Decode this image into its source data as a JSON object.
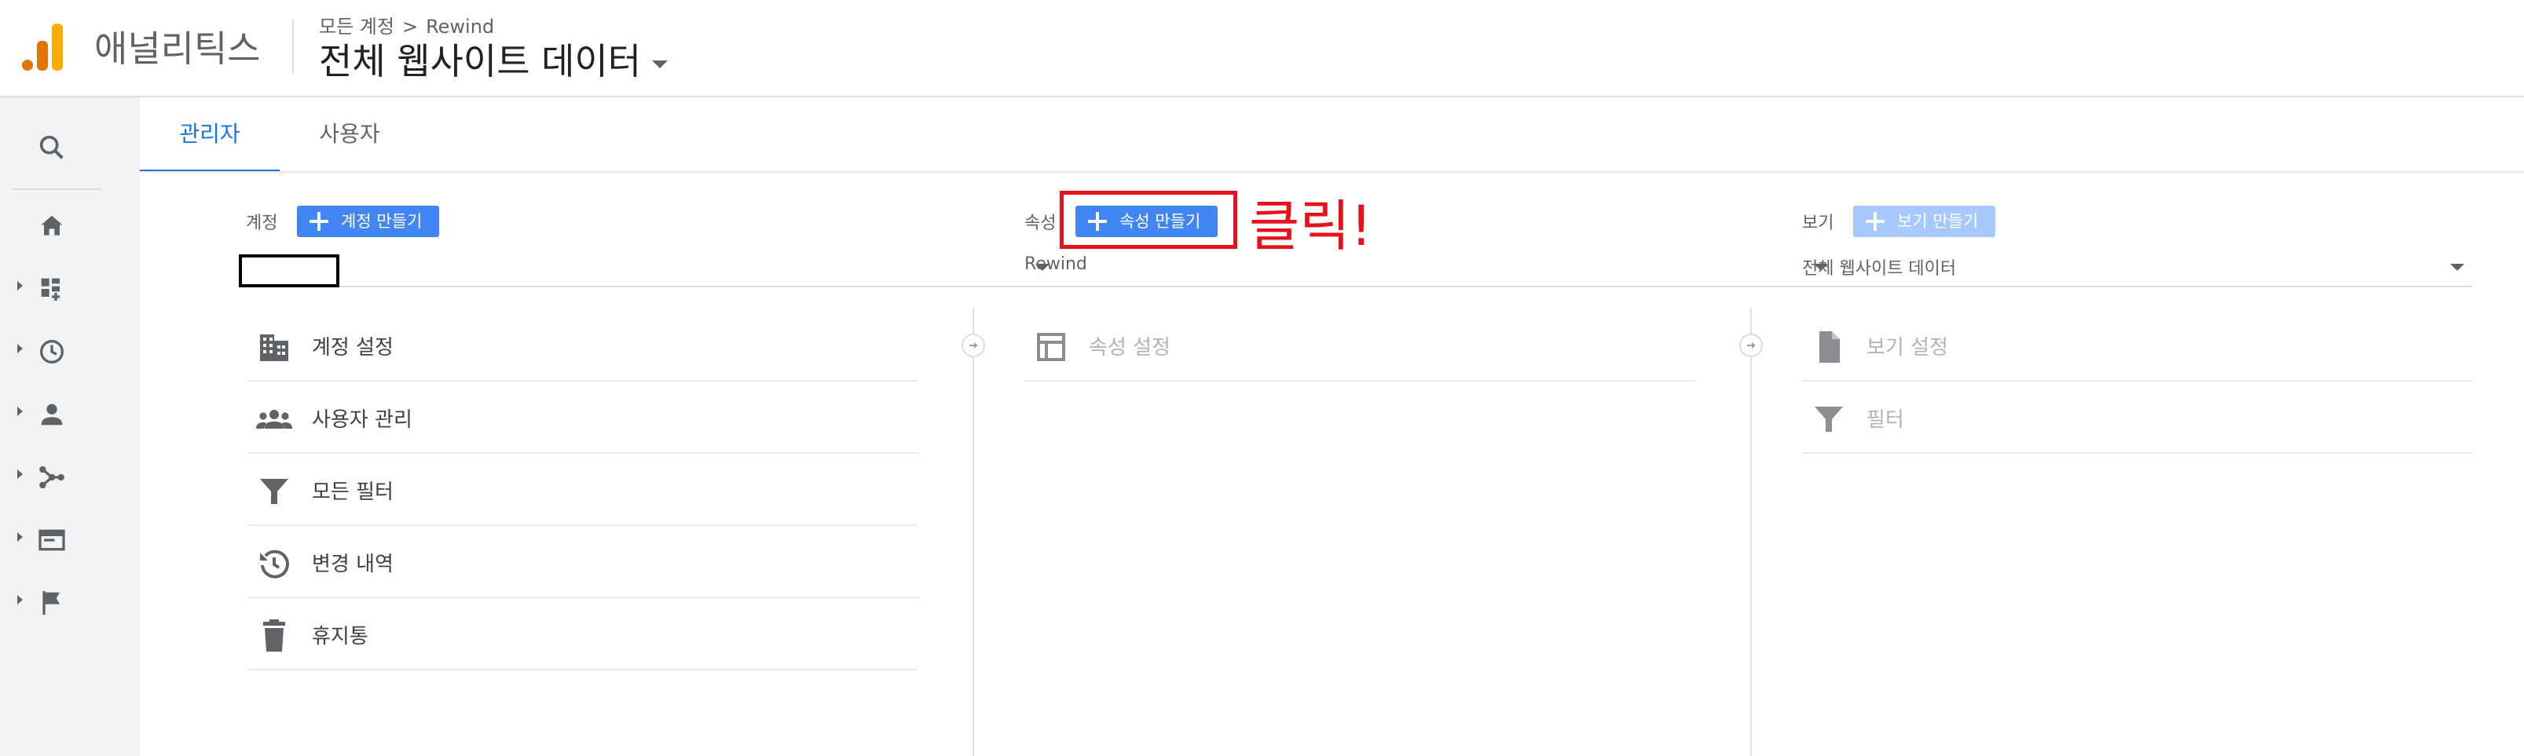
{
  "app": {
    "product_name": "애널리틱스",
    "breadcrumb": {
      "all_accounts": "모든 계정",
      "separator": ">",
      "property": "Rewind"
    },
    "view_title": "전체 웹사이트 데이터"
  },
  "tabs": [
    {
      "label": "관리자",
      "active": true
    },
    {
      "label": "사용자",
      "active": false
    }
  ],
  "account_column": {
    "label": "계정",
    "create_button": "계정 만들기",
    "selector_value": "",
    "items": [
      {
        "label": "계정 설정",
        "icon": "building-icon"
      },
      {
        "label": "사용자 관리",
        "icon": "people-icon"
      },
      {
        "label": "모든 필터",
        "icon": "filter-icon"
      },
      {
        "label": "변경 내역",
        "icon": "history-icon"
      },
      {
        "label": "휴지통",
        "icon": "trash-icon"
      }
    ]
  },
  "property_column": {
    "label": "속성",
    "create_button": "속성 만들기",
    "selector_value": "Rewind",
    "items": [
      {
        "label": "속성 설정",
        "icon": "layout-icon"
      }
    ]
  },
  "view_column": {
    "label": "보기",
    "create_button": "보기 만들기",
    "selector_value": "전체 웹사이트 데이터",
    "items": [
      {
        "label": "보기 설정",
        "icon": "document-icon"
      },
      {
        "label": "필터",
        "icon": "filter-icon"
      }
    ]
  },
  "annotation": {
    "text": "클릭!",
    "color": "#e8101b"
  },
  "colors": {
    "accent": "#1a73e8",
    "button": "#4285f4",
    "logo_orange": "#f9ab00"
  }
}
